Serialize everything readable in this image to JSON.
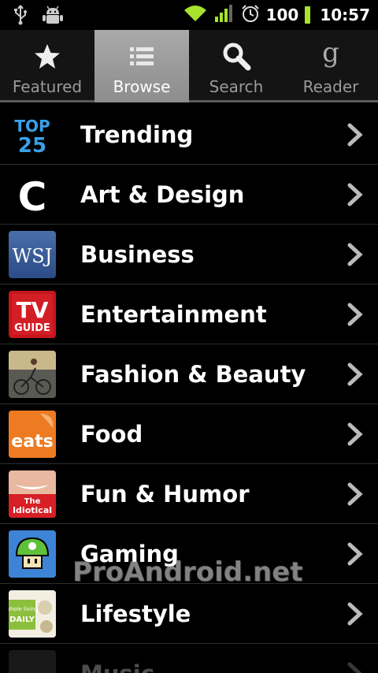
{
  "status_bar": {
    "battery": "100",
    "time": "10:57",
    "icons": [
      "usb-icon",
      "android-debug-icon",
      "wifi-icon",
      "signal-icon",
      "alarm-icon",
      "battery-icon"
    ]
  },
  "tabs": [
    {
      "label": "Featured",
      "icon": "star-icon",
      "active": false
    },
    {
      "label": "Browse",
      "icon": "list-icon",
      "active": true
    },
    {
      "label": "Search",
      "icon": "search-icon",
      "active": false
    },
    {
      "label": "Reader",
      "icon": "google-reader-icon",
      "active": false
    }
  ],
  "categories": [
    {
      "label": "Trending",
      "icon": "top25-icon"
    },
    {
      "label": "Art & Design",
      "icon": "c-icon"
    },
    {
      "label": "Business",
      "icon": "wsj-icon"
    },
    {
      "label": "Entertainment",
      "icon": "tv-guide-icon"
    },
    {
      "label": "Fashion & Beauty",
      "icon": "bicycle-photo-icon"
    },
    {
      "label": "Food",
      "icon": "eats-icon"
    },
    {
      "label": "Fun & Humor",
      "icon": "idiotical-icon"
    },
    {
      "label": "Gaming",
      "icon": "mushroom-icon"
    },
    {
      "label": "Lifestyle",
      "icon": "whole-living-icon"
    },
    {
      "label": "Music",
      "icon": "music-icon"
    }
  ],
  "thumb_text": {
    "top": "TOP",
    "n25": "25",
    "c": "C",
    "wsj": "WSJ",
    "tv": "TV",
    "guide": "GUIDE",
    "eats": "eats",
    "the": "The",
    "idiotical": "Idiotical",
    "whole_living": "whole living",
    "daily": "DAILY"
  },
  "watermark": "ProAndroid.net",
  "colors": {
    "active_tab": "#9e9e9e",
    "battery": "#a6e22e",
    "wifi": "#a6e22e"
  }
}
